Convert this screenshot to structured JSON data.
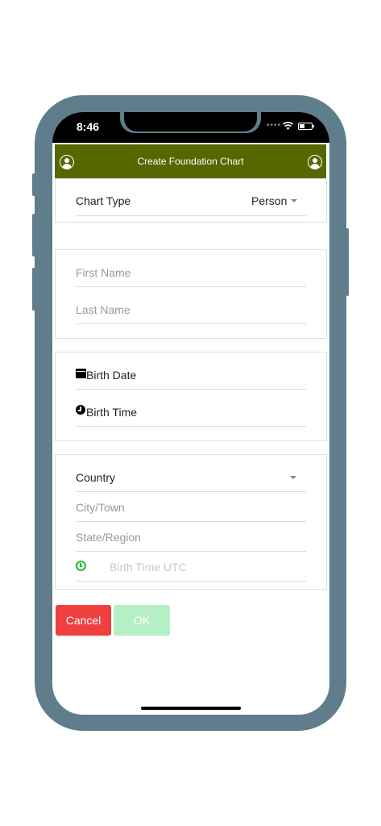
{
  "status_bar": {
    "time": "8:46",
    "signal_dots": "••••"
  },
  "header": {
    "title": "Create Foundation Chart"
  },
  "chart_type": {
    "label": "Chart Type",
    "value": "Person"
  },
  "name_fields": {
    "first_name_placeholder": "First Name",
    "last_name_placeholder": "Last Name"
  },
  "birth": {
    "date_label": "Birth Date",
    "time_label": "Birth Time"
  },
  "location": {
    "country_label": "Country",
    "city_placeholder": "City/Town",
    "state_placeholder": "State/Region",
    "utc_placeholder": "Birth Time UTC"
  },
  "actions": {
    "cancel_label": "Cancel",
    "ok_label": "OK"
  },
  "colors": {
    "header_bg": "#566700",
    "device_frame": "#5f7d8b",
    "cancel_bg": "#f03f3f",
    "ok_bg": "#b4efc6",
    "utc_icon": "#1fbf2b"
  },
  "icons": [
    "user-avatar-icon",
    "calendar-icon",
    "clock-icon",
    "utc-clock-icon",
    "dropdown-caret-icon",
    "wifi-icon",
    "battery-icon"
  ]
}
